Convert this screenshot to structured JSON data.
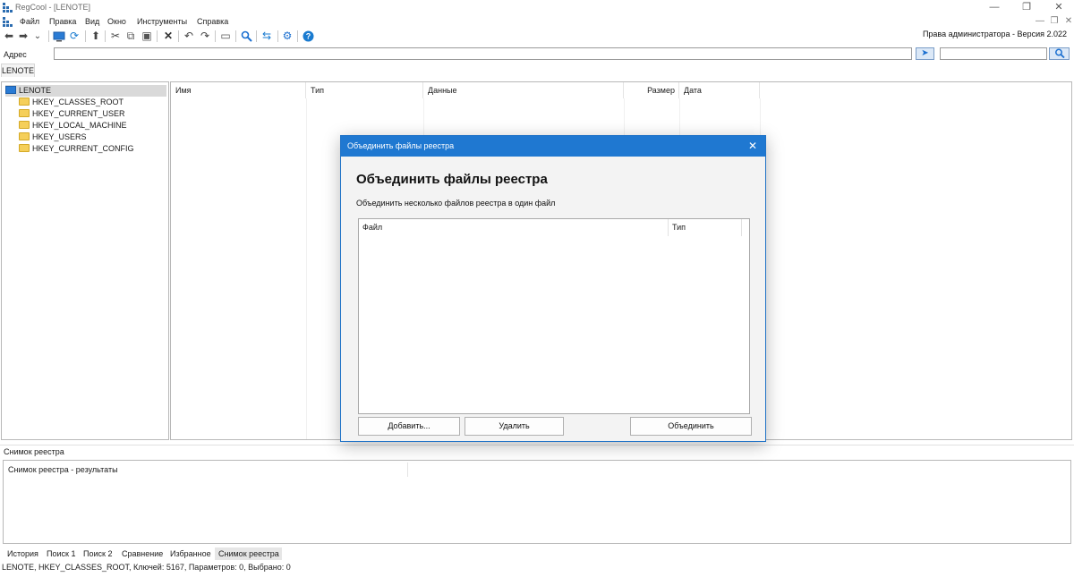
{
  "window": {
    "title": "RegCool - [LENOTE]",
    "controls": {
      "minimize": "—",
      "restore": "❐",
      "close": "✕"
    }
  },
  "menu": {
    "items": [
      "Файл",
      "Правка",
      "Вид",
      "Окно",
      "Инструменты",
      "Справка"
    ],
    "mdi_controls": {
      "minimize": "—",
      "restore": "❐",
      "close": "✕"
    }
  },
  "toolbar": {
    "icons": [
      "back-arrow-icon",
      "forward-arrow-icon",
      "dropdown-icon",
      "computer-icon",
      "refresh-icon",
      "up-arrow-icon",
      "cut-icon",
      "copy-icon",
      "paste-icon",
      "delete-icon",
      "undo-icon",
      "redo-icon",
      "new-key-icon",
      "find-icon",
      "compare-icon",
      "settings-icon",
      "help-icon"
    ],
    "admin_version": "Права администратора - Версия 2.022"
  },
  "address": {
    "label": "Адрес",
    "value": "",
    "search_value": ""
  },
  "computer_tab": "LENOTE",
  "tree": {
    "root": "LENOTE",
    "hives": [
      "HKEY_CLASSES_ROOT",
      "HKEY_CURRENT_USER",
      "HKEY_LOCAL_MACHINE",
      "HKEY_USERS",
      "HKEY_CURRENT_CONFIG"
    ]
  },
  "list": {
    "columns": [
      "Имя",
      "Тип",
      "Данные",
      "Размер",
      "Дата"
    ]
  },
  "snapshot": {
    "title": "Снимок реестра",
    "results_header": "Снимок реестра - результаты"
  },
  "bottom_tabs": {
    "items": [
      "История",
      "Поиск 1",
      "Поиск 2",
      "Сравнение",
      "Избранное",
      "Снимок реестра"
    ],
    "active": "Снимок реестра"
  },
  "status": "LENOTE, HKEY_CLASSES_ROOT, Ключей: 5167, Параметров: 0, Выбрано: 0",
  "dialog": {
    "title": "Объединить файлы реестра",
    "heading": "Объединить файлы реестра",
    "description": "Объединить несколько файлов реестра в один файл",
    "columns": [
      "Файл",
      "Тип"
    ],
    "buttons": {
      "add": "Добавить...",
      "remove": "Удалить",
      "merge": "Объединить"
    },
    "close": "✕"
  }
}
